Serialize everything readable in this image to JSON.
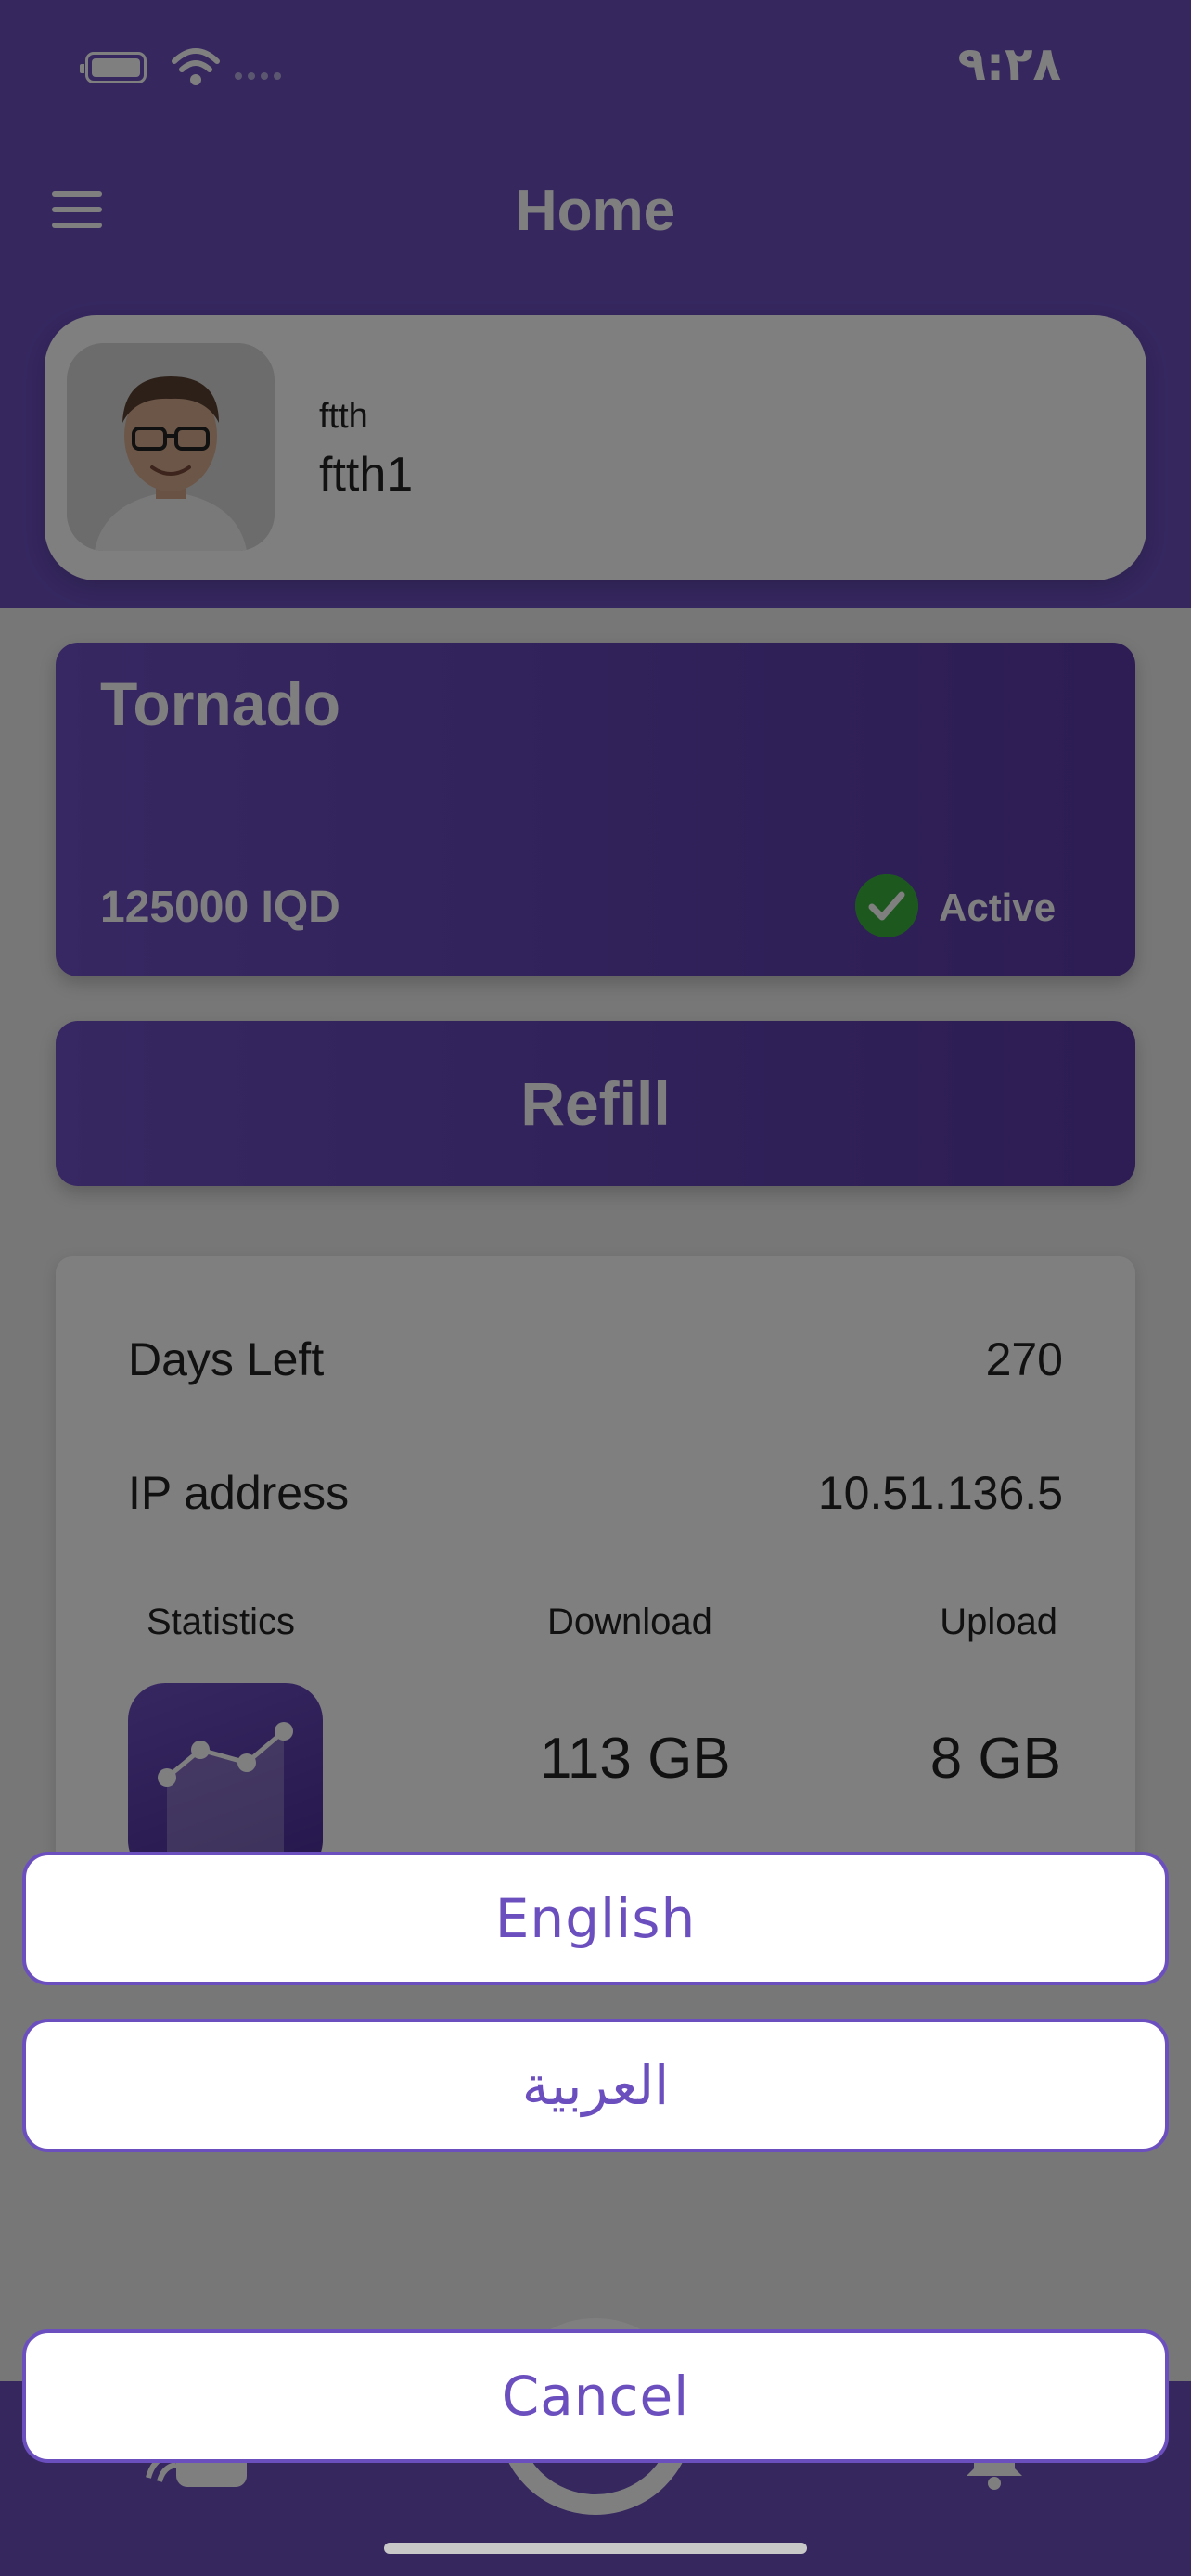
{
  "status_bar": {
    "time": "٩:٢٨"
  },
  "header": {
    "title": "Home"
  },
  "profile": {
    "subtitle": "ftth",
    "name": "ftth1"
  },
  "plan": {
    "name": "Tornado",
    "price": "125000 IQD",
    "status": "Active"
  },
  "actions": {
    "refill_label": "Refill"
  },
  "info": {
    "days_left_label": "Days Left",
    "days_left_value": "270",
    "ip_label": "IP address",
    "ip_value": "10.51.136.5",
    "statistics_label": "Statistics",
    "download_label": "Download",
    "upload_label": "Upload",
    "download_value": "113 GB",
    "upload_value": "8 GB"
  },
  "language_sheet": {
    "options": [
      "English",
      "العربية"
    ],
    "cancel_label": "Cancel"
  },
  "colors": {
    "accent": "#6c4fbf",
    "active": "#3bb23f"
  }
}
